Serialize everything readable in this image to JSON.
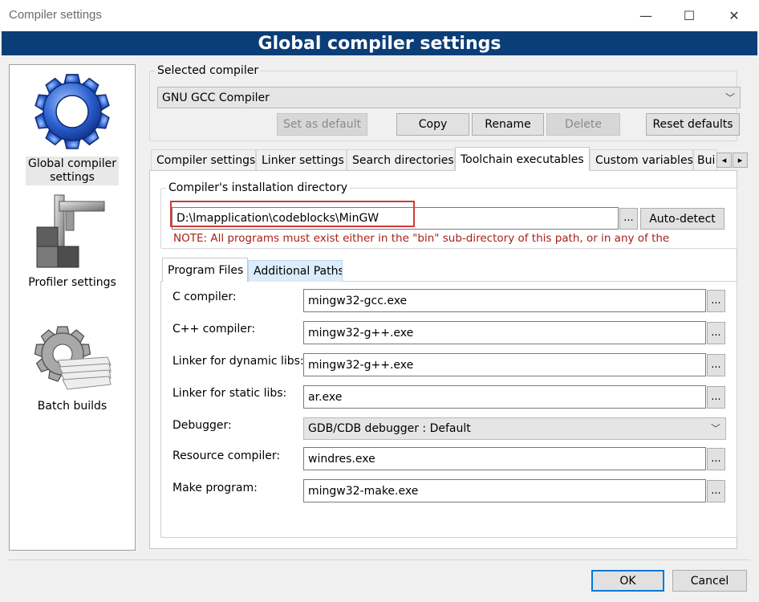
{
  "window": {
    "title": "Compiler settings",
    "minimize_glyph": "—",
    "maximize_glyph": "☐",
    "close_glyph": "✕"
  },
  "banner": {
    "title": "Global compiler settings"
  },
  "nav": {
    "items": [
      {
        "label_line1": "Global compiler",
        "label_line2": "settings",
        "icon": "gear-icon"
      },
      {
        "label": "Profiler settings",
        "icon": "caliper-icon"
      },
      {
        "label": "Batch builds",
        "icon": "gear-stack-icon"
      }
    ]
  },
  "selected_compiler": {
    "legend": "Selected compiler",
    "value": "GNU GCC Compiler",
    "buttons": {
      "set_default": "Set as default",
      "copy": "Copy",
      "rename": "Rename",
      "delete": "Delete",
      "reset": "Reset defaults"
    }
  },
  "tabs": [
    "Compiler settings",
    "Linker settings",
    "Search directories",
    "Toolchain executables",
    "Custom variables",
    "Bui"
  ],
  "tab_scroll": {
    "left": "◂",
    "right": "▸"
  },
  "install_dir": {
    "legend": "Compiler's installation directory",
    "value": "D:\\lmapplication\\codeblocks\\MinGW",
    "browse": "...",
    "autodetect": "Auto-detect",
    "note": "NOTE: All programs must exist either in the \"bin\" sub-directory of this path, or in any of the"
  },
  "subtabs": [
    "Program Files",
    "Additional Paths"
  ],
  "programs": [
    {
      "label": "C compiler:",
      "value": "mingw32-gcc.exe"
    },
    {
      "label": "C++ compiler:",
      "value": "mingw32-g++.exe"
    },
    {
      "label": "Linker for dynamic libs:",
      "value": "mingw32-g++.exe"
    },
    {
      "label": "Linker for static libs:",
      "value": "ar.exe"
    },
    {
      "label": "Debugger:",
      "value": "GDB/CDB debugger : Default"
    },
    {
      "label": "Resource compiler:",
      "value": "windres.exe"
    },
    {
      "label": "Make program:",
      "value": "mingw32-make.exe"
    }
  ],
  "dots": "...",
  "dropdown_arrow": "﹀",
  "footer": {
    "ok": "OK",
    "cancel": "Cancel"
  },
  "colors": {
    "banner": "#0b3e78",
    "note": "#a8201a",
    "highlight": "#d03a3a",
    "ok_border": "#0078d7"
  }
}
